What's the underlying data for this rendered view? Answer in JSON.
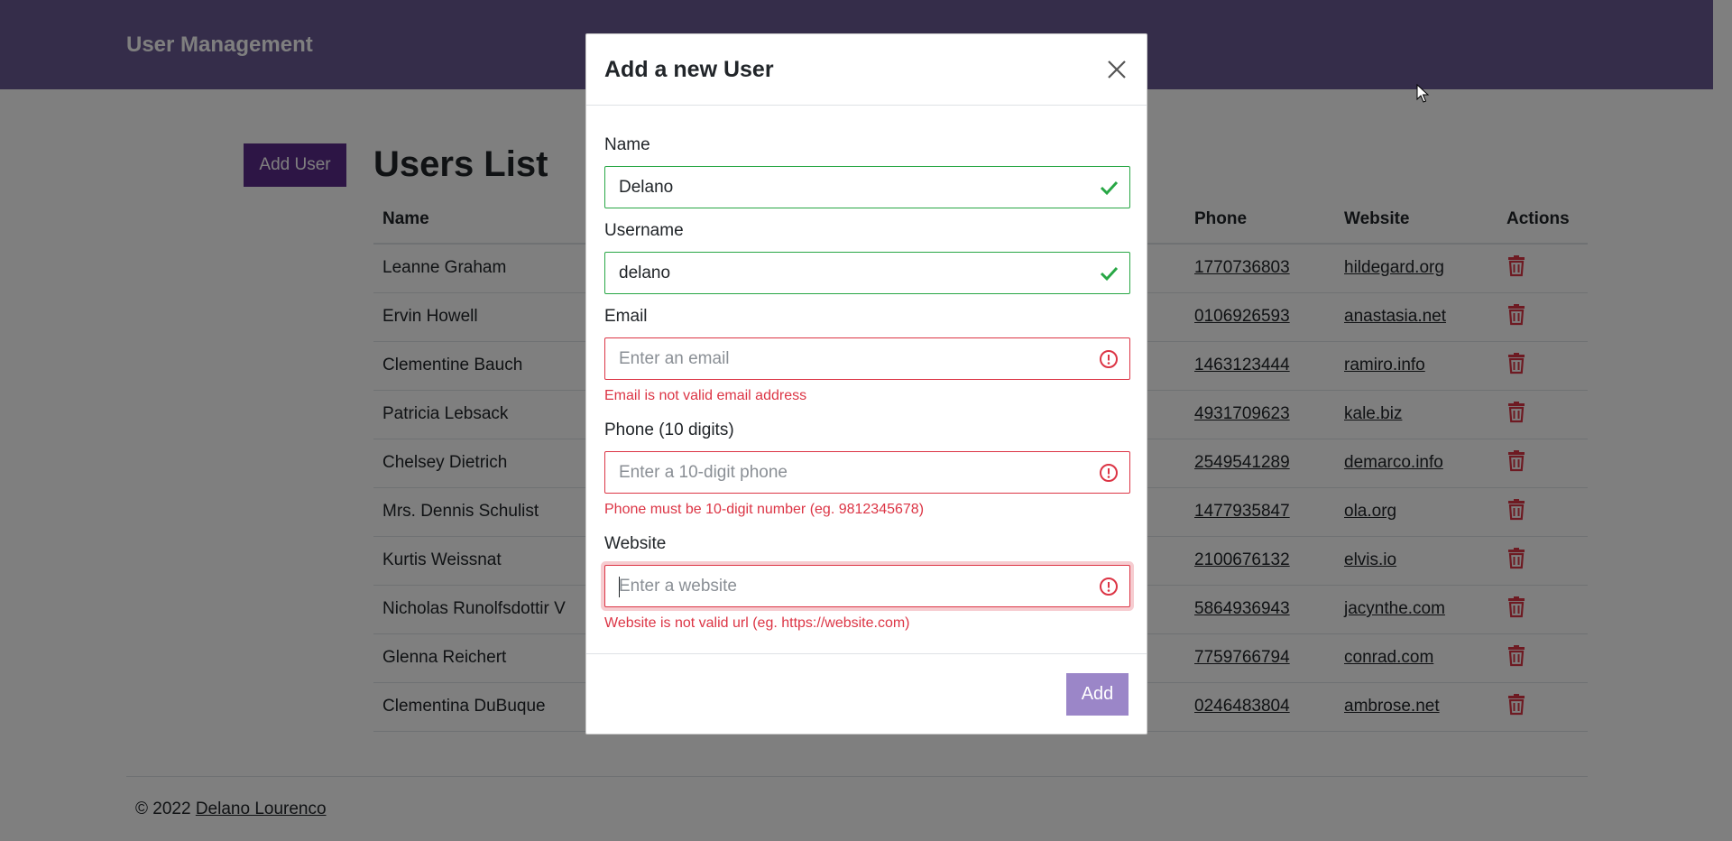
{
  "app": {
    "brand": "User Management"
  },
  "main": {
    "add_user_label": "Add User",
    "title": "Users List",
    "columns": {
      "name": "Name",
      "phone": "Phone",
      "website": "Website",
      "actions": "Actions"
    },
    "rows": [
      {
        "name": "Leanne Graham",
        "phone": "1770736803",
        "website": "hildegard.org"
      },
      {
        "name": "Ervin Howell",
        "phone": "0106926593",
        "website": "anastasia.net"
      },
      {
        "name": "Clementine Bauch",
        "phone": "1463123444",
        "website": "ramiro.info"
      },
      {
        "name": "Patricia Lebsack",
        "phone": "4931709623",
        "website": "kale.biz"
      },
      {
        "name": "Chelsey Dietrich",
        "phone": "2549541289",
        "website": "demarco.info"
      },
      {
        "name": "Mrs. Dennis Schulist",
        "phone": "1477935847",
        "website": "ola.org"
      },
      {
        "name": "Kurtis Weissnat",
        "phone": "2100676132",
        "website": "elvis.io"
      },
      {
        "name": "Nicholas Runolfsdottir V",
        "phone": "5864936943",
        "website": "jacynthe.com"
      },
      {
        "name": "Glenna Reichert",
        "phone": "7759766794",
        "website": "conrad.com"
      },
      {
        "name": "Clementina DuBuque",
        "phone": "0246483804",
        "website": "ambrose.net"
      }
    ]
  },
  "footer": {
    "copyright": "© 2022",
    "author": "Delano Lourenco"
  },
  "modal": {
    "title": "Add a new User",
    "name": {
      "label": "Name",
      "value": "Delano"
    },
    "username": {
      "label": "Username",
      "value": "delano"
    },
    "email": {
      "label": "Email",
      "placeholder": "Enter an email",
      "error": "Email is not valid email address"
    },
    "phone": {
      "label": "Phone (10 digits)",
      "placeholder": "Enter a 10-digit phone",
      "error": "Phone must be 10-digit number (eg. 9812345678)"
    },
    "website": {
      "label": "Website",
      "placeholder": "Enter a website",
      "error": "Website is not valid url (eg. https://website.com)"
    },
    "submit_label": "Add"
  },
  "colors": {
    "navbar": "#6b5b95",
    "primary_button": "#5a2a8a",
    "modal_button": "#9b86c8",
    "valid": "#28a745",
    "invalid": "#dc3545"
  },
  "icons": {
    "close": "close-icon",
    "valid": "check-icon",
    "invalid": "exclamation-circle-icon",
    "delete": "trash-icon",
    "cursor": "mouse-pointer-icon"
  }
}
